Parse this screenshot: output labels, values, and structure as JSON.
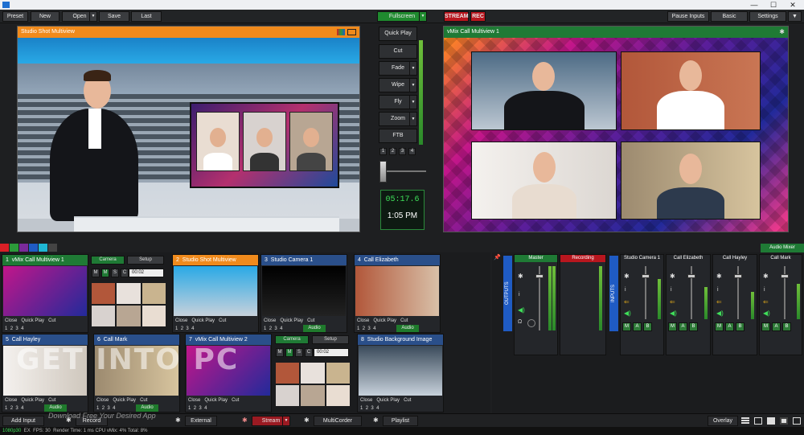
{
  "topbar": {
    "preset": "Preset",
    "new": "New",
    "open": "Open",
    "save": "Save",
    "last": "Last",
    "fullscreen": "Fullscreen",
    "stream": "STREAM",
    "rec": "REC",
    "pause_inputs": "Pause Inputs",
    "basic": "Basic",
    "settings": "Settings"
  },
  "preview": {
    "title": "Studio Shot  Multiview",
    "accent": "#f08a1c"
  },
  "program": {
    "title": "vMix Call Multiview 1",
    "accent": "#1f7a35"
  },
  "transitions": {
    "items": [
      "Quick Play",
      "Cut",
      "Fade",
      "Wipe",
      "Fly",
      "Zoom",
      "FTB"
    ],
    "numbers": [
      "1",
      "2",
      "3",
      "4"
    ]
  },
  "clock": {
    "elapsed": "05:17.6",
    "time": "1:05 PM"
  },
  "swatch_colors": [
    "#d81f26",
    "#2c9a3a",
    "#7a2a9a",
    "#1f5bc4",
    "#1fb7d4",
    "#444"
  ],
  "inputs": [
    {
      "num": "1",
      "name": "vMix Call Multiview 1",
      "color": "#1f7a35",
      "controls": [
        "Close",
        "Quick Play",
        "Cut"
      ],
      "numbers": [
        "1",
        "2",
        "3",
        "4"
      ],
      "side": {
        "camera": "Camera",
        "setup": "Setup",
        "m": "M",
        "s": "S",
        "c": "C",
        "delay": "00:02"
      }
    },
    {
      "num": "2",
      "name": "Studio Shot Multiview",
      "color": "#f08a1c",
      "controls": [
        "Close",
        "Quick Play",
        "Cut"
      ],
      "numbers": [
        "1",
        "2",
        "3",
        "4"
      ]
    },
    {
      "num": "3",
      "name": "Studio Camera 1",
      "color": "#2a4f8a",
      "controls": [
        "Close",
        "Quick Play",
        "Cut"
      ],
      "numbers": [
        "1",
        "2",
        "3",
        "4"
      ],
      "audio": "Audio"
    },
    {
      "num": "4",
      "name": "Call Elizabeth",
      "color": "#2a4f8a",
      "controls": [
        "Close",
        "Quick Play",
        "Cut"
      ],
      "numbers": [
        "1",
        "2",
        "3",
        "4"
      ],
      "audio": "Audio"
    },
    {
      "num": "5",
      "name": "Call Hayley",
      "color": "#2a4f8a",
      "controls": [
        "Close",
        "Quick Play",
        "Cut"
      ],
      "numbers": [
        "1",
        "2",
        "3",
        "4"
      ],
      "audio": "Audio"
    },
    {
      "num": "6",
      "name": "Call Mark",
      "color": "#2a4f8a",
      "controls": [
        "Close",
        "Quick Play",
        "Cut"
      ],
      "numbers": [
        "1",
        "2",
        "3",
        "4"
      ],
      "audio": "Audio"
    },
    {
      "num": "7",
      "name": "vMix Call Multiview 2",
      "color": "#2a4f8a",
      "controls": [
        "Close",
        "Quick Play",
        "Cut"
      ],
      "numbers": [
        "1",
        "2",
        "3",
        "4"
      ],
      "side": {
        "camera": "Camera",
        "setup": "Setup",
        "m": "M",
        "s": "S",
        "c": "C",
        "delay": "00:02"
      }
    },
    {
      "num": "8",
      "name": "Studio Background Image",
      "color": "#2a4f8a",
      "controls": [
        "Close",
        "Quick Play",
        "Cut"
      ],
      "numbers": [
        "1",
        "2",
        "3",
        "4"
      ]
    }
  ],
  "audio": {
    "mixer_label": "Audio Mixer",
    "outputs_label": "OUTPUTS",
    "inputs_label": "INPUTS",
    "master": "Master",
    "recording": "Recording",
    "channels": [
      "Studio Camera 1",
      "Call Elizabeth",
      "Call Hayley",
      "Call Mark"
    ],
    "bus": [
      "M",
      "A",
      "B"
    ]
  },
  "bottombar": {
    "add_input": "Add Input",
    "record": "Record",
    "external": "External",
    "stream": "Stream",
    "multicorder": "MultiCorder",
    "playlist": "Playlist",
    "overlay": "Overlay"
  },
  "status": {
    "res": "1080p30",
    "ex": "EX",
    "fps_label": "FPS:",
    "fps": "30",
    "render_label": "Render Time:",
    "render": "1 ms",
    "cpu_label": "CPU vMix:",
    "cpu": "4%",
    "total_label": "Total:",
    "total": "8%"
  },
  "watermark": {
    "main": "GET INTO PC",
    "sub": "Download Free Your Desired App"
  }
}
